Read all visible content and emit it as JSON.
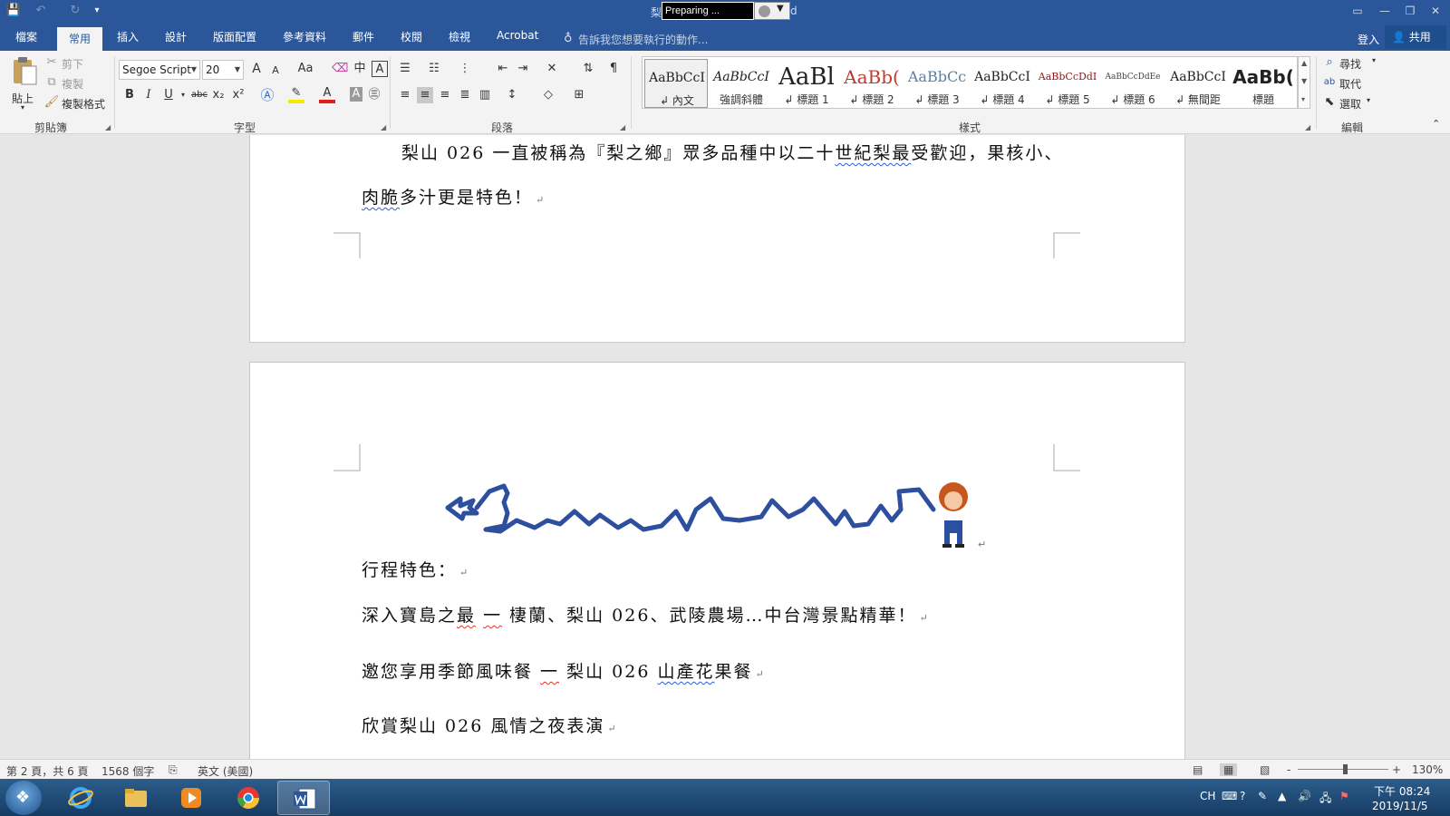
{
  "window": {
    "title_fragment": "梨",
    "title_suffix": "d",
    "recorder_status": "Preparing ...",
    "min": "—",
    "restore": "❐",
    "close": "✕",
    "ribbon_opts": "▭"
  },
  "quick_access": {
    "save": "💾",
    "undo": "↶",
    "redo": "↻",
    "customize": "▾"
  },
  "tabs": [
    {
      "label": "檔案"
    },
    {
      "label": "常用",
      "active": true
    },
    {
      "label": "插入"
    },
    {
      "label": "設計"
    },
    {
      "label": "版面配置"
    },
    {
      "label": "參考資料"
    },
    {
      "label": "郵件"
    },
    {
      "label": "校閱"
    },
    {
      "label": "檢視"
    },
    {
      "label": "Acrobat"
    }
  ],
  "tell_me": "告訴我您想要執行的動作...",
  "login": "登入",
  "share": "共用",
  "ribbon": {
    "clipboard": {
      "label": "剪貼簿",
      "paste": "貼上",
      "cut": "剪下",
      "copy": "複製",
      "format_painter": "複製格式"
    },
    "font": {
      "label": "字型",
      "font_name": "Segoe Script",
      "font_size": "20",
      "grow": "A",
      "shrink": "A",
      "case": "Aa",
      "bold": "B",
      "italic": "I",
      "underline": "U",
      "strike": "abc",
      "subscript": "x₂",
      "superscript": "x²",
      "font_color": "A",
      "char_shading": "A"
    },
    "paragraph": {
      "label": "段落"
    },
    "styles": {
      "label": "樣式",
      "items": [
        {
          "sample": "AaBbCcI",
          "name": "↲ 內文",
          "selected": true,
          "color": "#222222"
        },
        {
          "sample": "AaBbCcI",
          "name": "強調斜體",
          "color": "#222222"
        },
        {
          "sample": "AaBl",
          "name": "↲ 標題 1",
          "color": "#222222"
        },
        {
          "sample": "AaBb(",
          "name": "↲ 標題 2",
          "color": "#c0392b"
        },
        {
          "sample": "AaBbCc",
          "name": "↲ 標題 3",
          "color": "#5b7fa6"
        },
        {
          "sample": "AaBbCcI",
          "name": "↲ 標題 4",
          "color": "#333333"
        },
        {
          "sample": "AaBbCcDdI",
          "name": "↲ 標題 5",
          "color": "#8b1a1a"
        },
        {
          "sample": "AaBbCcDdEe",
          "name": "↲ 標題 6",
          "color": "#444444"
        },
        {
          "sample": "AaBbCcI",
          "name": "↲ 無間距",
          "color": "#222222"
        },
        {
          "sample": "AaBb(",
          "name": "標題",
          "color": "#111111"
        }
      ]
    },
    "editing": {
      "label": "編輯",
      "find": "尋找",
      "replace": "取代",
      "select": "選取"
    }
  },
  "document": {
    "page1_line1_a": "梨山 026 一直被稱為『梨之鄉』眾多品種中以二十",
    "page1_line1_b": "世紀梨最",
    "page1_line1_c": "受歡迎，果核小、",
    "page1_line2_a": "肉脆",
    "page1_line2_b": "多汁更是特色！",
    "page2_heading": "行程特色：",
    "page2_line1_a": "深入寶島之",
    "page2_line1_b": "最",
    "page2_line1_c": " ",
    "page2_line1_d": "一",
    "page2_line1_e": " 棲蘭、梨山 026、武陵農場…中台灣景點精華！",
    "page2_line2_a": "邀您享用季節風味餐 ",
    "page2_line2_b": "一",
    "page2_line2_c": " 梨山 026 ",
    "page2_line2_d": "山產花",
    "page2_line2_e": "果餐",
    "page2_line3": "欣賞梨山 026 風情之夜表演",
    "para_mark": "↵"
  },
  "status": {
    "page": "第 2 頁，共 6 頁",
    "words": "1568 個字",
    "language": "英文 (美國)",
    "zoom": "130%",
    "zoom_minus": "-",
    "zoom_plus": "+",
    "zoom_level": 0.52
  },
  "taskbar": {
    "ime": "CH",
    "time": "下午 08:24",
    "date": "2019/11/5"
  },
  "colors": {
    "word_blue": "#2b579a",
    "ribbon_bg": "#f3f3f3",
    "doc_bg": "#e6e6e6",
    "spell_red": "#e0342b",
    "grammar_blue": "#2a5fd8",
    "drawing_blue": "#2e4e9e"
  }
}
